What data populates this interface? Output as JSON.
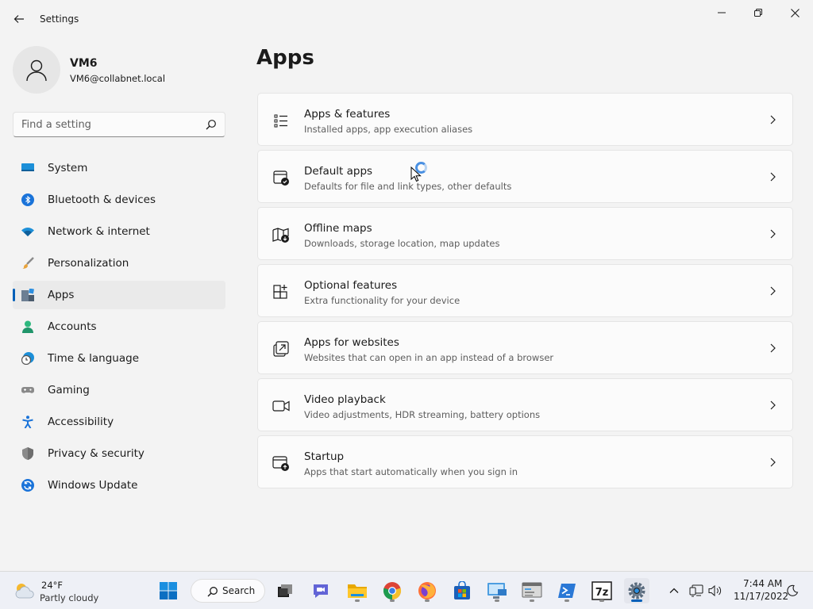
{
  "window": {
    "title": "Settings",
    "controls": {
      "minimize": "minimize",
      "maximize": "maximize",
      "close": "close"
    }
  },
  "profile": {
    "name": "VM6",
    "email": "VM6@collabnet.local"
  },
  "search": {
    "placeholder": "Find a setting"
  },
  "sidebar": {
    "items": [
      {
        "label": "System",
        "icon": "monitor-icon"
      },
      {
        "label": "Bluetooth & devices",
        "icon": "bluetooth-icon"
      },
      {
        "label": "Network & internet",
        "icon": "wifi-icon"
      },
      {
        "label": "Personalization",
        "icon": "brush-icon"
      },
      {
        "label": "Apps",
        "icon": "apps-icon",
        "selected": true
      },
      {
        "label": "Accounts",
        "icon": "person-icon"
      },
      {
        "label": "Time & language",
        "icon": "clock-globe-icon"
      },
      {
        "label": "Gaming",
        "icon": "gamepad-icon"
      },
      {
        "label": "Accessibility",
        "icon": "accessibility-icon"
      },
      {
        "label": "Privacy & security",
        "icon": "shield-icon"
      },
      {
        "label": "Windows Update",
        "icon": "update-icon"
      }
    ]
  },
  "main": {
    "title": "Apps",
    "cards": [
      {
        "title": "Apps & features",
        "description": "Installed apps, app execution aliases",
        "icon": "list-icon"
      },
      {
        "title": "Default apps",
        "description": "Defaults for file and link types, other defaults",
        "icon": "default-apps-icon"
      },
      {
        "title": "Offline maps",
        "description": "Downloads, storage location, map updates",
        "icon": "map-download-icon"
      },
      {
        "title": "Optional features",
        "description": "Extra functionality for your device",
        "icon": "grid-add-icon"
      },
      {
        "title": "Apps for websites",
        "description": "Websites that can open in an app instead of a browser",
        "icon": "open-link-icon"
      },
      {
        "title": "Video playback",
        "description": "Video adjustments, HDR streaming, battery options",
        "icon": "video-icon"
      },
      {
        "title": "Startup",
        "description": "Apps that start automatically when you sign in",
        "icon": "startup-icon"
      }
    ]
  },
  "taskbar": {
    "weather": {
      "temperature": "24°F",
      "condition": "Partly cloudy",
      "icon": "partly-cloudy-icon"
    },
    "search_label": "Search",
    "apps": [
      {
        "name": "start-button",
        "icon": "windows-logo-icon"
      },
      {
        "name": "task-view",
        "icon": "task-view-icon"
      },
      {
        "name": "teams-chat",
        "icon": "chat-icon"
      },
      {
        "name": "file-explorer",
        "icon": "folder-icon"
      },
      {
        "name": "chrome",
        "icon": "chrome-icon"
      },
      {
        "name": "firefox",
        "icon": "firefox-icon"
      },
      {
        "name": "microsoft-store",
        "icon": "store-icon"
      },
      {
        "name": "remote-desktop",
        "icon": "remote-desktop-icon"
      },
      {
        "name": "server-manager",
        "icon": "server-icon"
      },
      {
        "name": "powershell",
        "icon": "terminal-icon"
      },
      {
        "name": "seven-zip",
        "icon": "archive-icon",
        "label": "7z"
      },
      {
        "name": "settings",
        "icon": "gear-icon",
        "active": true
      }
    ],
    "clock": {
      "time": "7:44 AM",
      "date": "11/17/2022"
    }
  },
  "colors": {
    "accent": "#005fb8",
    "background": "#f3f3f3",
    "card": "#fbfbfb",
    "taskbar": "#eef0f6"
  }
}
